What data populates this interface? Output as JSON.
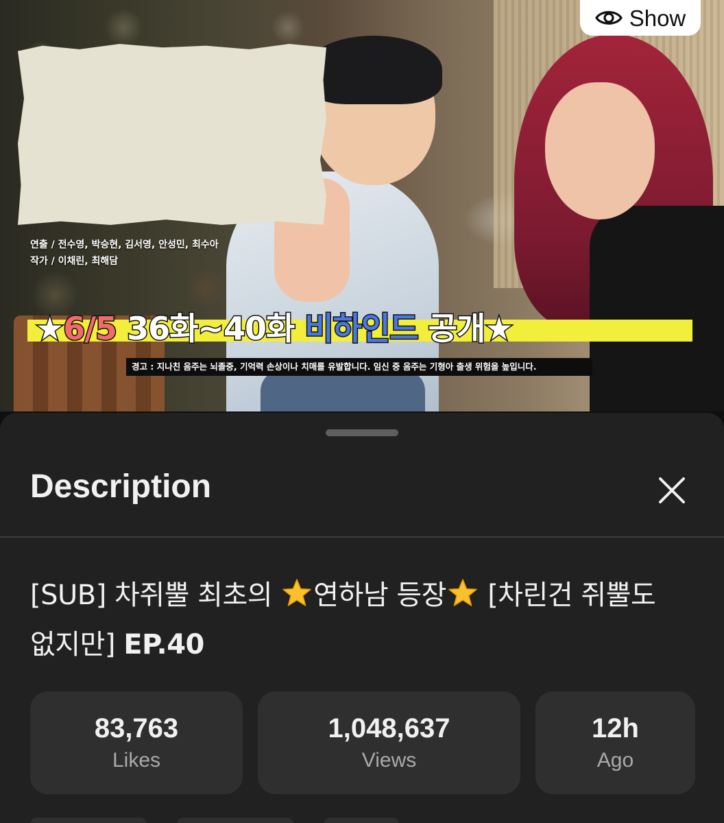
{
  "thumbnail": {
    "show_label": "Show",
    "credits_line1": "연출 / 전수영, 박승현, 김서영, 안성민, 최수아",
    "credits_line2": "작가 / 이채린, 최해담",
    "headline_prefix": "★",
    "headline_date": "6/5",
    "headline_mid": " 36화~40화 ",
    "headline_blue": "비하인드",
    "headline_suffix": " 공개★",
    "warning": "경고 : 지나친 음주는 뇌졸중, 기억력 손상이나 치매를 유발합니다. 임신 중 음주는 기형아 출생 위험을 높입니다."
  },
  "sheet": {
    "title": "Description",
    "video_title_part1": "[SUB] 차쥐뿔 최초의 ",
    "video_title_part2": "연하남 등장",
    "video_title_part3": "  [차린건 쥐뿔도 없지만] ",
    "video_title_ep": "EP.40",
    "stats": [
      {
        "value": "83,763",
        "label": "Likes"
      },
      {
        "value": "1,048,637",
        "label": "Views"
      },
      {
        "value": "12h",
        "label": "Ago"
      }
    ]
  },
  "colors": {
    "sheet_bg": "#212121",
    "stat_bg": "#2f2f2f",
    "headline_yellow": "#f2ee3c",
    "headline_red": "#f36a6a",
    "headline_blue": "#4a78e2"
  },
  "icons": [
    "eye-icon",
    "close-icon",
    "star-emoji-icon"
  ]
}
